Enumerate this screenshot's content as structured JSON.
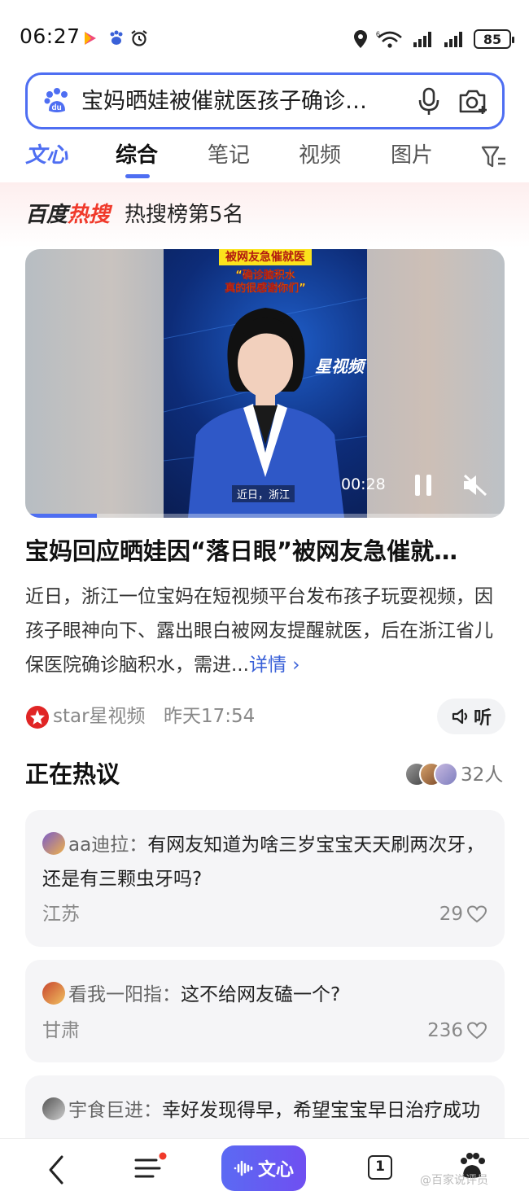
{
  "status_bar": {
    "time": "06:27",
    "battery": "85",
    "signal_label": "6"
  },
  "search": {
    "query": "宝妈晒娃被催就医孩子确诊…",
    "logo_text": "du"
  },
  "tabs": [
    {
      "label": "文心"
    },
    {
      "label": "综合"
    },
    {
      "label": "笔记"
    },
    {
      "label": "视频"
    },
    {
      "label": "图片"
    }
  ],
  "hot": {
    "logo_left": "百度",
    "logo_right": "热搜",
    "rank": "热搜榜第5名"
  },
  "video": {
    "headline": "被网友急催就医",
    "quote_line1": "“确诊脑积水",
    "quote_line2": "真的很感谢你们”",
    "brand": "星视频",
    "caption": "近日，浙江",
    "time": "00:28",
    "progress": 0.15
  },
  "article": {
    "title": "宝妈回应晒娃因“落日眼”被网友急催就…",
    "summary": "近日，浙江一位宝妈在短视频平台发布孩子玩耍视频，因孩子眼神向下、露出眼白被网友提醒就医，后在浙江省儿保医院确诊脑积水，需进...",
    "more": "详情 ›",
    "source": "star星视频",
    "time": "昨天17:54",
    "listen": "听"
  },
  "discussion": {
    "title": "正在热议",
    "people": "32人",
    "comments": [
      {
        "user": "aa迪拉：",
        "text": "有网友知道为啥三岁宝宝天天刷两次牙，还是有三颗虫牙吗?",
        "location": "江苏",
        "likes": "29"
      },
      {
        "user": "看我一阳指：",
        "text": "这不给网友磕一个?",
        "location": "甘肃",
        "likes": "236"
      },
      {
        "user": "宇食巨进：",
        "text": "幸好发现得早，希望宝宝早日治疗成功"
      }
    ]
  },
  "bottom_nav": {
    "wenxin": "文心",
    "tab_count": "1",
    "watermark": "@百家说评员"
  },
  "colors": {
    "brand_blue": "#4e6ef2",
    "hot_red": "#f03a2b",
    "link_blue": "#3a61d8"
  },
  "icons": [
    "baidu-logo-icon",
    "microphone-icon",
    "camera-icon",
    "filter-icon",
    "pause-icon",
    "mute-icon",
    "speaker-icon",
    "heart-icon",
    "back-icon",
    "menu-icon",
    "baidu-paw-icon",
    "alarm-icon",
    "location-icon",
    "wifi-icon",
    "signal-icon"
  ]
}
